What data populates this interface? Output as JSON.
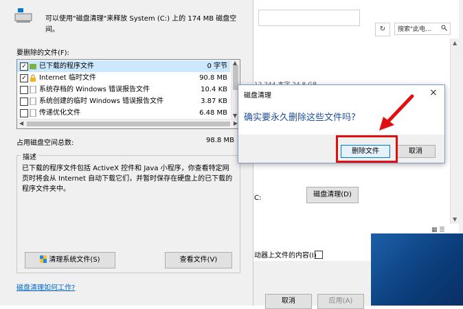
{
  "background_window": {
    "search_placeholder": "搜索\"此电...",
    "refresh_symbol": "↻",
    "partial_text": "12 244 本字    24.8 GB",
    "drive_c_label": "C:",
    "disk_cleanup_button": "磁盘清理(D)",
    "content_label": "动器上文件的内容(I)",
    "cancel_button": "取消",
    "apply_button": "应用(A)"
  },
  "cleanup_dialog": {
    "intro_text": "可以使用\"磁盘清理\"来释放 System (C:) 上的 174 MB 磁盘空间。",
    "files_to_delete_label": "要删除的文件(F):",
    "files": [
      {
        "checked": true,
        "icon": "folder",
        "name": "已下载的程序文件",
        "size": "0 字节"
      },
      {
        "checked": true,
        "icon": "lock",
        "name": "Internet 临时文件",
        "size": "90.8 MB"
      },
      {
        "checked": false,
        "icon": "doc",
        "name": "系统存档的 Windows 错误报告文件",
        "size": "10.4 KB"
      },
      {
        "checked": false,
        "icon": "doc",
        "name": "系统创建的临时 Windows 错误报告文件",
        "size": "3.87 KB"
      },
      {
        "checked": false,
        "icon": "doc",
        "name": "传递优化文件",
        "size": "6.48 MB"
      }
    ],
    "total_label": "占用磁盘空间总数:",
    "total_value": "98.8 MB",
    "description_label": "描述",
    "description_text": "已下载的程序文件包括 ActiveX 控件和 Java 小程序，你查看特定网页时将会从 Internet 自动下载它们，并暂时保存在硬盘上的已下载的程序文件夹中。",
    "clean_system_button": "清理系统文件(S)",
    "view_files_button": "查看文件(V)",
    "how_it_works_link": "磁盘清理如何工作?"
  },
  "confirm_dialog": {
    "title": "磁盘清理",
    "close_symbol": "×",
    "question": "确实要永久删除这些文件吗?",
    "delete_button": "删除文件",
    "cancel_button": "取消"
  },
  "colors": {
    "annotation_red": "#e01010",
    "question_blue": "#1e4e9e",
    "link_blue": "#0066cc"
  }
}
